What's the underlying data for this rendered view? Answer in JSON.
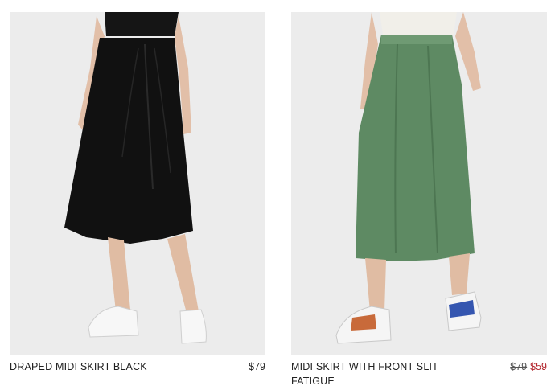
{
  "products": [
    {
      "name": "DRAPED MIDI SKIRT BLACK",
      "price": "$79",
      "image_desc": "black draped midi skirt"
    },
    {
      "name": "MIDI SKIRT WITH FRONT SLIT FATIGUE",
      "original_price": "$79",
      "sale_price": "$59",
      "image_desc": "green wide midi skirt"
    }
  ],
  "colors": {
    "photo_bg": "#ececec",
    "skirt_black": "#111111",
    "skirt_green": "#5e8a63",
    "sale_red": "#b3262d"
  }
}
